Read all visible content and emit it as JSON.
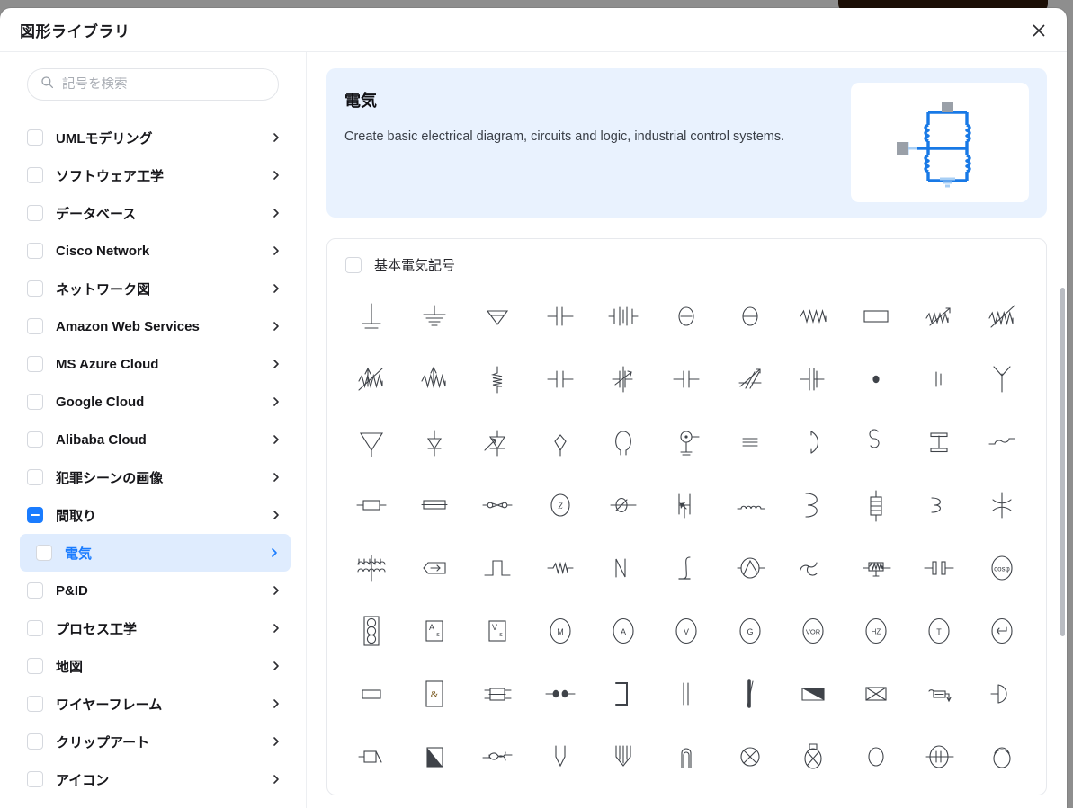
{
  "dialog": {
    "title": "図形ライブラリ",
    "close_label": "×",
    "close_icon": "close-icon"
  },
  "search": {
    "placeholder": "記号を検索",
    "value": "",
    "icon": "search-icon"
  },
  "colors": {
    "accent": "#1a7cff",
    "selected_bg": "#dfecfe",
    "banner_bg": "#e9f2fe",
    "symbol_stroke": "#3f4349",
    "thumb_blue": "#1879e6"
  },
  "sidebar": {
    "items": [
      {
        "label": "UMLモデリング",
        "checkbox": "unchecked",
        "selected": false,
        "child": false
      },
      {
        "label": "ソフトウェア工学",
        "checkbox": "unchecked",
        "selected": false,
        "child": false
      },
      {
        "label": "データベース",
        "checkbox": "unchecked",
        "selected": false,
        "child": false
      },
      {
        "label": "Cisco Network",
        "checkbox": "unchecked",
        "selected": false,
        "child": false
      },
      {
        "label": "ネットワーク図",
        "checkbox": "unchecked",
        "selected": false,
        "child": false
      },
      {
        "label": "Amazon Web Services",
        "checkbox": "unchecked",
        "selected": false,
        "child": false
      },
      {
        "label": "MS Azure Cloud",
        "checkbox": "unchecked",
        "selected": false,
        "child": false
      },
      {
        "label": "Google Cloud",
        "checkbox": "unchecked",
        "selected": false,
        "child": false
      },
      {
        "label": "Alibaba Cloud",
        "checkbox": "unchecked",
        "selected": false,
        "child": false
      },
      {
        "label": "犯罪シーンの画像",
        "checkbox": "unchecked",
        "selected": false,
        "child": false
      },
      {
        "label": "間取り",
        "checkbox": "indeterminate",
        "selected": false,
        "child": false
      },
      {
        "label": "電気",
        "checkbox": "unchecked",
        "selected": true,
        "child": true
      },
      {
        "label": "P&ID",
        "checkbox": "unchecked",
        "selected": false,
        "child": false
      },
      {
        "label": "プロセス工学",
        "checkbox": "unchecked",
        "selected": false,
        "child": false
      },
      {
        "label": "地図",
        "checkbox": "unchecked",
        "selected": false,
        "child": false
      },
      {
        "label": "ワイヤーフレーム",
        "checkbox": "unchecked",
        "selected": false,
        "child": false
      },
      {
        "label": "クリップアート",
        "checkbox": "unchecked",
        "selected": false,
        "child": false
      },
      {
        "label": "アイコン",
        "checkbox": "unchecked",
        "selected": false,
        "child": false
      }
    ]
  },
  "banner": {
    "title": "電気",
    "description": "Create basic electrical diagram, circuits and logic, industrial control systems.",
    "thumbnail_name": "electrical-resistor-circuit-preview"
  },
  "symbol_group": {
    "title": "基本電気記号",
    "checkbox": "unchecked",
    "symbols": [
      "ground-earth",
      "earth-chassis",
      "signal-ground",
      "capacitor-small",
      "battery-cells",
      "lamp-oval",
      "lamp-oval-line",
      "resistor-zigzag",
      "resistor-box",
      "resistor-variable-arrow",
      "resistor-variable-double",
      "resistor-tapped-arrow",
      "resistor-zigzag-arrow",
      "resistor-vertical-zigzag",
      "capacitor-plain",
      "capacitor-variable",
      "capacitor-polar",
      "capacitor-trimmer",
      "capacitor-feedthrough",
      "junction-dot",
      "terminal-plate",
      "antenna-dipole",
      "antenna-triangle",
      "diode-vertical",
      "diode-photo",
      "diode-diamond",
      "lamp-bulb",
      "microphone-earth",
      "battery-stack",
      "coil-half",
      "coil-s-shape",
      "crystal-resonator",
      "ac-source-wave",
      "fuse-box",
      "fuse-rect",
      "switch-crossed",
      "impedance-z",
      "ammeter-inline",
      "thyristor-vertical",
      "inductor-coil",
      "coil-3-shape",
      "resistor-ladder",
      "coil-bracket",
      "transformer-cross",
      "transformer-multi-winding",
      "tag-arrow-left",
      "pulse-waveform",
      "damped-wave",
      "sawtooth-wave",
      "integrator",
      "generator-circle",
      "sine-wave",
      "heater-element",
      "capacitor-pair",
      "cos-phi-meter",
      "traffic-signal",
      "meter-a-s",
      "meter-v-s",
      "meter-m",
      "meter-a",
      "meter-v",
      "meter-g",
      "meter-vor",
      "meter-hz",
      "meter-t",
      "meter-return",
      "box-rect",
      "logic-and-gate",
      "relay-contact",
      "contact-double-dot",
      "bracket-right",
      "parallel-lines",
      "bar-slash",
      "gradient-triangle",
      "envelope-cross",
      "relay-coil-switch",
      "buffer-gate",
      "terminal-block-left",
      "triangle-filled-half",
      "coil-crossed",
      "fork-v",
      "coil-w",
      "loop-arch",
      "lamp-crossed-circle",
      "bell-crossed",
      "ellipse-plain",
      "meter-ellipse-bar",
      "ellipse-arc"
    ]
  }
}
